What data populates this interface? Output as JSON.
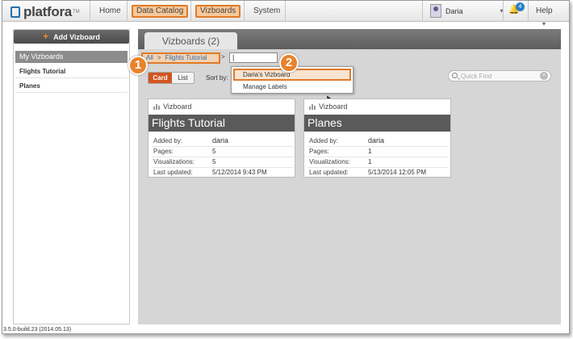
{
  "app": {
    "name": "platfora",
    "tm": "TM",
    "version": "3.5.0-build.23 (2014.05.13)"
  },
  "nav": {
    "home": "Home",
    "data_catalog": "Data Catalog",
    "vizboards": "Vizboards",
    "system": "System",
    "user": "Daria",
    "notifications": "4",
    "help": "Help"
  },
  "sidebar": {
    "add_label": "Add Vizboard",
    "section": "My Vizboards",
    "items": [
      "Flights Tutorial",
      "Planes"
    ]
  },
  "main": {
    "tab": "Vizboards (2)",
    "breadcrumb": {
      "all": "All",
      "current": "Flights Tutorial"
    },
    "input_value": "|",
    "dropdown": [
      "Daria's Vizboard",
      "Manage Labels"
    ],
    "view": {
      "card": "Card",
      "list": "List"
    },
    "sort_label": "Sort by:",
    "quick_find_placeholder": "Quick Find",
    "callouts": [
      "1",
      "2"
    ]
  },
  "cards": [
    {
      "type": "Vizboard",
      "title": "Flights Tutorial",
      "rows": [
        {
          "label": "Added by:",
          "value": "daria"
        },
        {
          "label": "Pages:",
          "value": "5"
        },
        {
          "label": "Visualizations:",
          "value": "5"
        },
        {
          "label": "Last updated:",
          "value": "5/12/2014 9:43 PM"
        }
      ]
    },
    {
      "type": "Vizboard",
      "title": "Planes",
      "rows": [
        {
          "label": "Added by:",
          "value": "daria"
        },
        {
          "label": "Pages:",
          "value": "1"
        },
        {
          "label": "Visualizations:",
          "value": "1"
        },
        {
          "label": "Last updated:",
          "value": "5/13/2014 12:05 PM"
        }
      ]
    }
  ],
  "colors": {
    "accent": "#e07a28",
    "active_toggle": "#d2551f",
    "link": "#2a6fb8"
  }
}
